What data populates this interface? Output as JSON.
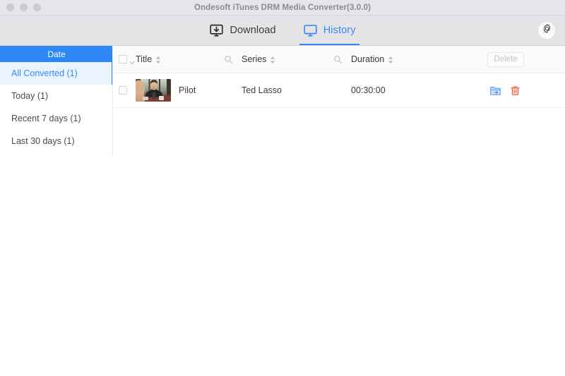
{
  "window": {
    "title": "Ondesoft iTunes DRM Media Converter(3.0.0)",
    "traffic_lights": [
      "close",
      "minimize",
      "zoom"
    ]
  },
  "toolbar": {
    "tabs": [
      {
        "label": "Download",
        "icon": "download-monitor-icon",
        "active": false
      },
      {
        "label": "History",
        "icon": "history-monitor-icon",
        "active": true
      }
    ],
    "settings_icon": "gear-icon",
    "accent_color": "#3b86f7"
  },
  "sidebar": {
    "header": "Date",
    "items": [
      {
        "label": "All Converted (1)",
        "selected": true
      },
      {
        "label": "Today (1)",
        "selected": false
      },
      {
        "label": "Recent 7 days (1)",
        "selected": false
      },
      {
        "label": "Last 30 days (1)",
        "selected": false
      }
    ],
    "selected_bg": "#e9f4fe",
    "header_bg": "#2f86f6"
  },
  "table": {
    "select_all_checked": false,
    "columns": [
      {
        "key": "title",
        "label": "Title",
        "sortable": true,
        "searchable": true
      },
      {
        "key": "series",
        "label": "Series",
        "sortable": true,
        "searchable": true
      },
      {
        "key": "duration",
        "label": "Duration",
        "sortable": true,
        "searchable": false
      }
    ],
    "delete_button": {
      "label": "Delete",
      "disabled": true
    },
    "rows": [
      {
        "checked": false,
        "thumbnail": "video-thumbnail",
        "title": "Pilot",
        "series": "Ted Lasso",
        "duration": "00:30:00",
        "actions": [
          {
            "name": "open-folder-icon",
            "color": "#5b9bf0"
          },
          {
            "name": "delete-row-icon",
            "color": "#f2574c"
          }
        ]
      }
    ]
  }
}
